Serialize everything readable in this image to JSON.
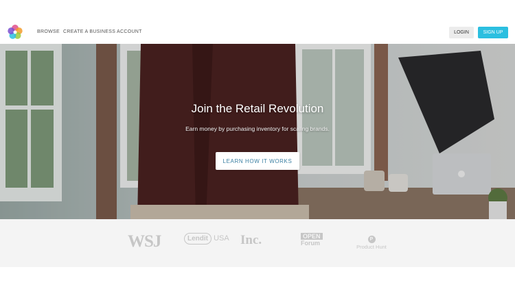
{
  "header": {
    "logo_icon": "flower-logo-icon",
    "nav": [
      {
        "label": "BROWSE"
      },
      {
        "label": "CREATE A BUSINESS ACCOUNT"
      }
    ],
    "login_label": "LOGIN",
    "signup_label": "SIGN UP",
    "accent_color": "#2bbfe0"
  },
  "hero": {
    "title": "Join the Retail Revolution",
    "subtitle": "Earn money by purchasing inventory for scaling brands.",
    "cta_label": "LEARN HOW IT WORKS",
    "cta_text_color": "#3a7fa2"
  },
  "press": {
    "logos": [
      {
        "name": "WSJ",
        "text": "WSJ"
      },
      {
        "name": "LendIt USA",
        "text_le": "Lendit",
        "text_usa": "USA"
      },
      {
        "name": "Inc.",
        "text": "Inc."
      },
      {
        "name": "OPEN Forum",
        "text_open": "OPEN",
        "text_forum": "Forum"
      },
      {
        "name": "Product Hunt",
        "badge": "P",
        "text": "Product Hunt"
      }
    ]
  }
}
